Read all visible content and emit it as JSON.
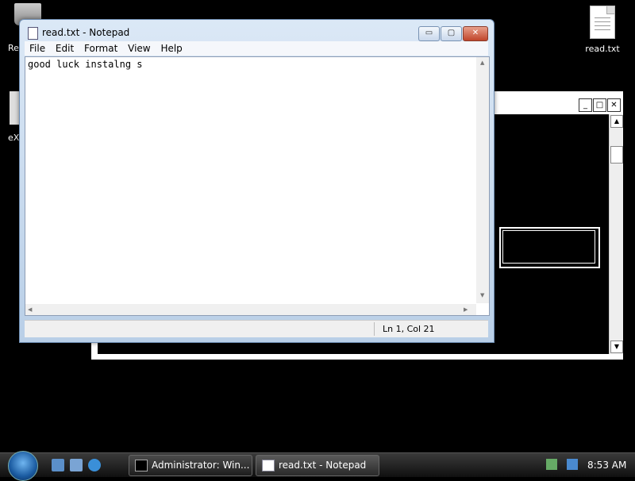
{
  "desktop": {
    "recycle_label_partial": "Re",
    "exe_label_partial": "eX",
    "file_label": "read.txt"
  },
  "notepad": {
    "title": "read.txt - Notepad",
    "menu": [
      "File",
      "Edit",
      "Format",
      "View",
      "Help"
    ],
    "content": "good luck instalng s",
    "status": "Ln 1, Col 21",
    "buttons": {
      "minimize": "▭",
      "maximize": "▢",
      "close": "✕"
    }
  },
  "console": {
    "buttons": {
      "minimize": "_",
      "maximize": "□",
      "close": "✕"
    }
  },
  "taskbar": {
    "tasks": [
      {
        "label": "Administrator:  Win..."
      },
      {
        "label": "read.txt - Notepad"
      }
    ],
    "clock": "8:53 AM"
  },
  "colors": {
    "desktop_bg": "#000000",
    "notepad_frame": "#b9cfe7",
    "close_button": "#c0452b"
  }
}
